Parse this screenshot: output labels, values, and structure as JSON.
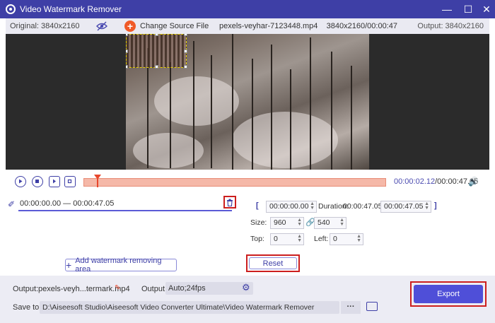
{
  "window": {
    "title": "Video Watermark Remover",
    "icon": "app-icon",
    "controls": [
      "minimize-icon",
      "maximize-icon",
      "close-icon"
    ]
  },
  "info": {
    "original": "Original: 3840x2160",
    "change_source": "Change Source File",
    "file": "pexels-veyhar-7123448.mp4",
    "file_meta": "3840x2160/00:00:47",
    "output": "Output: 3840x2160"
  },
  "playback": {
    "current_time": "00:00:02.12",
    "total_time": "/00:00:47.05",
    "progress": 0.045
  },
  "segment": {
    "time_range": "00:00:00.00 — 00:00:47.05"
  },
  "add_area_label": "Add watermark removing area",
  "timing": {
    "start": "00:00:00.00",
    "duration_label": "Duration:",
    "duration": "00:00:47.05",
    "end": "00:00:47.05"
  },
  "size": {
    "label": "Size:",
    "width": "960",
    "height": "540"
  },
  "position": {
    "top_label": "Top:",
    "top": "0",
    "left_label": "Left:",
    "left": "0"
  },
  "reset_label": "Reset",
  "bottom": {
    "output_label": "Output:",
    "output_file": "pexels-veyh...termark.mp4",
    "format_label": "Output:",
    "format": "Auto;24fps",
    "save_label": "Save to:",
    "save_path": "D:\\Aiseesoft Studio\\Aiseesoft Video Converter Ultimate\\Video Watermark Remover",
    "more": "···",
    "export": "Export"
  },
  "colors": {
    "accent": "#3e3fa6",
    "export": "#4f4fd8",
    "highlight": "#cc1f1f",
    "timeline": "#f5b8a8"
  }
}
